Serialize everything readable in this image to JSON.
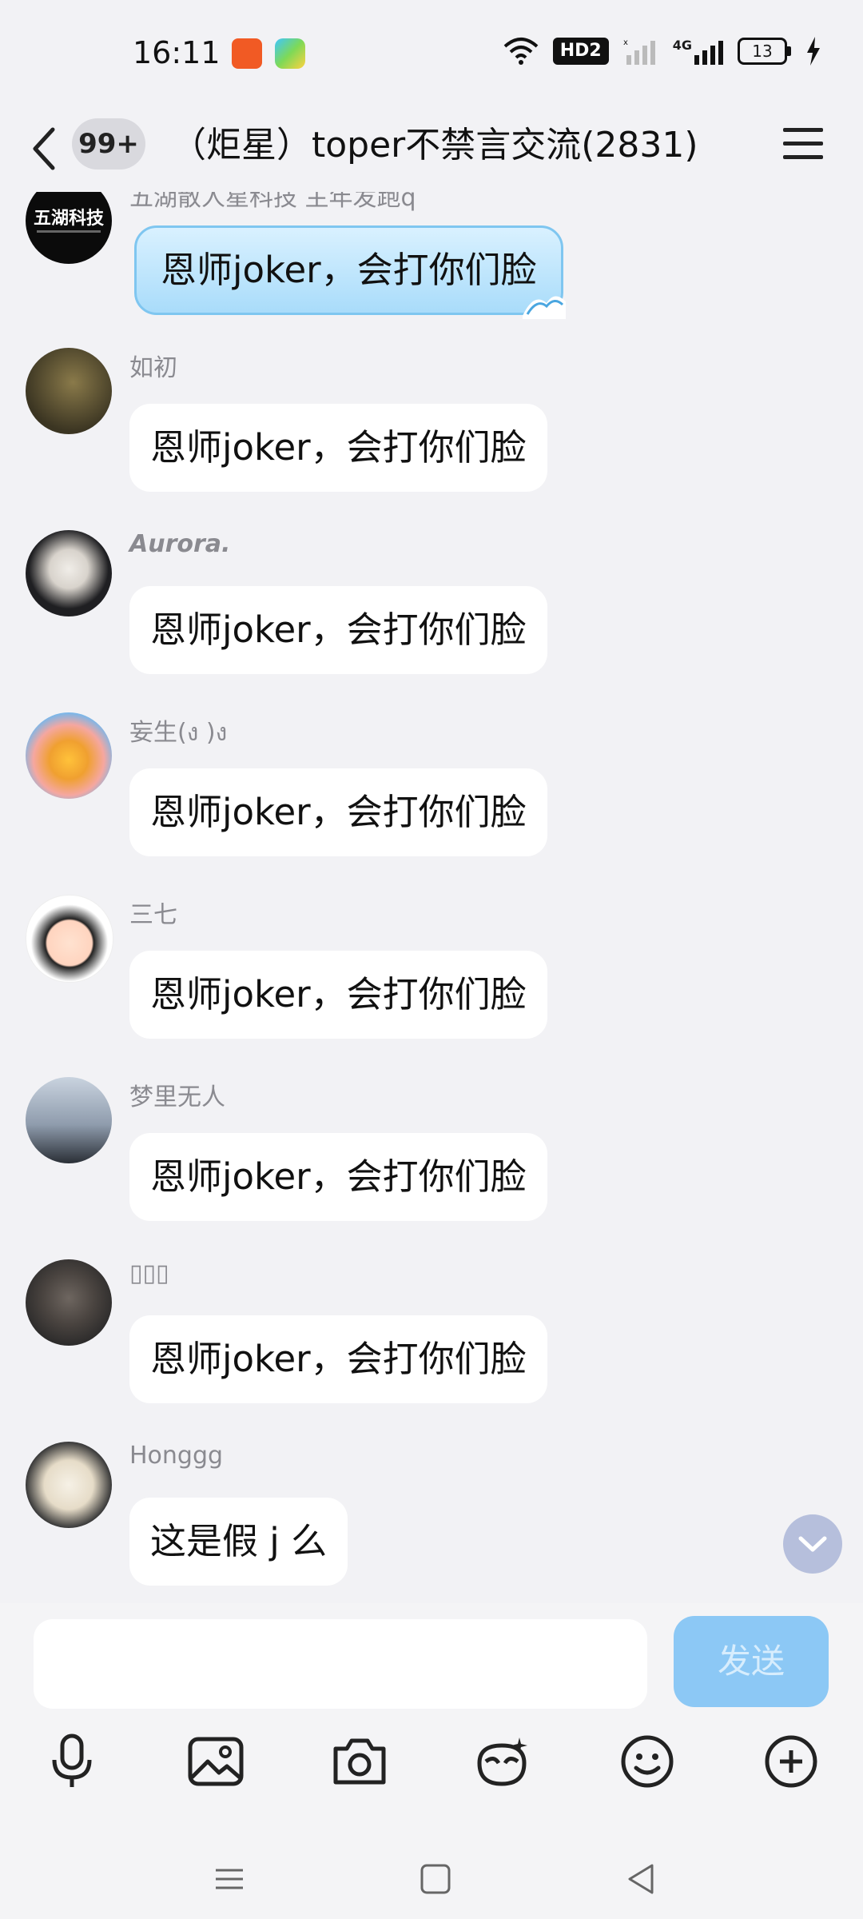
{
  "status_bar": {
    "time": "16:11",
    "hd_label": "HD2",
    "network": "4G",
    "battery": "13"
  },
  "header": {
    "unread_count": "99+",
    "title": "（炬星）toper不禁言交流(2831)"
  },
  "messages": [
    {
      "sender": "五湖散人星科技 主年发跑q",
      "text": "恩师joker，会打你们脸",
      "special": true
    },
    {
      "sender": "如初",
      "text": "恩师joker，会打你们脸"
    },
    {
      "sender": "Aurora.",
      "text": "恩师joker，会打你们脸"
    },
    {
      "sender": "妄生(ง )ง",
      "text": "恩师joker，会打你们脸"
    },
    {
      "sender": "三七",
      "text": "恩师joker，会打你们脸"
    },
    {
      "sender": "梦里无人",
      "text": "恩师joker，会打你们脸"
    },
    {
      "sender": "▯▯▯",
      "text": "恩师joker，会打你们脸"
    },
    {
      "sender": "Honggg",
      "text": "这是假 j 么"
    }
  ],
  "input": {
    "value": "",
    "send_label": "发送"
  },
  "avatar_text": "五湖科技",
  "icons": [
    "back-icon",
    "menu-icon",
    "mic-icon",
    "image-icon",
    "camera-icon",
    "mask-icon",
    "emoji-icon",
    "plus-icon",
    "nav-menu-icon",
    "nav-home-icon",
    "nav-back-icon",
    "chevron-down-icon"
  ],
  "colors": {
    "background": "#f2f2f5",
    "send_button": "#8cc8f5",
    "bubble": "#ffffff",
    "special_bubble": "#a9dcfa"
  }
}
